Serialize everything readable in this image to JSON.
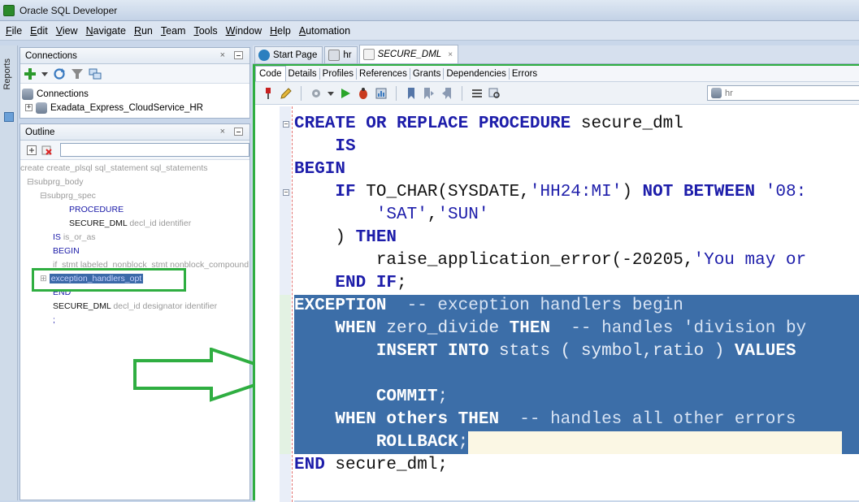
{
  "window": {
    "title": "Oracle SQL Developer"
  },
  "menu": [
    "File",
    "Edit",
    "View",
    "Navigate",
    "Run",
    "Team",
    "Tools",
    "Window",
    "Help",
    "Automation"
  ],
  "left_strip": {
    "reports_label": "Reports"
  },
  "connections_panel": {
    "title": "Connections",
    "close": "×",
    "tree": [
      {
        "label": "Connections"
      },
      {
        "label": "Exadata_Express_CloudService_HR"
      }
    ]
  },
  "outline_panel": {
    "title": "Outline",
    "close": "×",
    "items": [
      {
        "text": "create create_plsql sql_statement sql_statements"
      },
      {
        "text": "subprg_body"
      },
      {
        "text": "subprg_spec"
      },
      {
        "text": "PROCEDURE"
      },
      {
        "text": "SECURE_DML",
        "suffix": "decl_id identifier"
      },
      {
        "text": "IS",
        "suffix": "is_or_as"
      },
      {
        "text": "BEGIN"
      },
      {
        "text": "if_stmt labeled_nonblock_stmt nonblock_compound"
      },
      {
        "text": "exception_handlers_opt"
      },
      {
        "text": "END"
      },
      {
        "text": "SECURE_DML",
        "suffix": "decl_id designator identifier"
      },
      {
        "text": ";"
      }
    ]
  },
  "doc_tabs": [
    {
      "label": "Start Page"
    },
    {
      "label": "hr"
    },
    {
      "label": "SECURE_DML",
      "close": "×"
    }
  ],
  "sub_tabs": [
    "Code",
    "Details",
    "Profiles",
    "References",
    "Grants",
    "Dependencies",
    "Errors"
  ],
  "connection_selector": {
    "value": "hr"
  },
  "code": {
    "lines": [
      [
        [
          "kw",
          "CREATE OR REPLACE PROCEDURE"
        ],
        [
          "p",
          " secure_dml"
        ]
      ],
      [
        [
          "p",
          "    "
        ],
        [
          "kw",
          "IS"
        ]
      ],
      [
        [
          "kw",
          "BEGIN"
        ]
      ],
      [
        [
          "p",
          "    "
        ],
        [
          "kw",
          "IF"
        ],
        [
          "p",
          " TO_CHAR(SYSDATE,"
        ],
        [
          "str",
          "'HH24:MI'"
        ],
        [
          "p",
          ") "
        ],
        [
          "kw",
          "NOT BETWEEN"
        ],
        [
          "p",
          " "
        ],
        [
          "str",
          "'08:"
        ]
      ],
      [
        [
          "p",
          "        "
        ],
        [
          "str",
          "'SAT'"
        ],
        [
          "p",
          ","
        ],
        [
          "str",
          "'SUN'"
        ]
      ],
      [
        [
          "p",
          "    ) "
        ],
        [
          "kw",
          "THEN"
        ]
      ],
      [
        [
          "p",
          "        raise_application_error(-20205,"
        ],
        [
          "str",
          "'You may or"
        ]
      ],
      [
        [
          "p",
          "    "
        ],
        [
          "kw",
          "END IF"
        ],
        [
          "p",
          ";"
        ]
      ],
      [
        [
          "kw",
          "EXCEPTION"
        ],
        [
          "cm",
          "  -- exception handlers begin"
        ]
      ],
      [
        [
          "p",
          "    "
        ],
        [
          "kw",
          "WHEN"
        ],
        [
          "p",
          " zero_divide "
        ],
        [
          "kw",
          "THEN"
        ],
        [
          "cm",
          "  -- handles 'division by"
        ]
      ],
      [
        [
          "p",
          "        "
        ],
        [
          "kw",
          "INSERT INTO"
        ],
        [
          "p",
          " stats ( symbol,ratio ) "
        ],
        [
          "kw",
          "VALUES"
        ]
      ],
      [
        [
          "p",
          ""
        ]
      ],
      [
        [
          "p",
          "        "
        ],
        [
          "kw",
          "COMMIT"
        ],
        [
          "p",
          ";"
        ]
      ],
      [
        [
          "p",
          "    "
        ],
        [
          "kw",
          "WHEN others THEN"
        ],
        [
          "cm",
          "  -- handles all other errors"
        ]
      ],
      [
        [
          "p",
          "        "
        ],
        [
          "kw",
          "ROLLBACK"
        ],
        [
          "p",
          ";"
        ]
      ],
      [
        [
          "kw",
          "END"
        ],
        [
          "p",
          " secure_dml;"
        ]
      ]
    ],
    "selected_lines": [
      8,
      9,
      10,
      11,
      12,
      13,
      14
    ]
  }
}
